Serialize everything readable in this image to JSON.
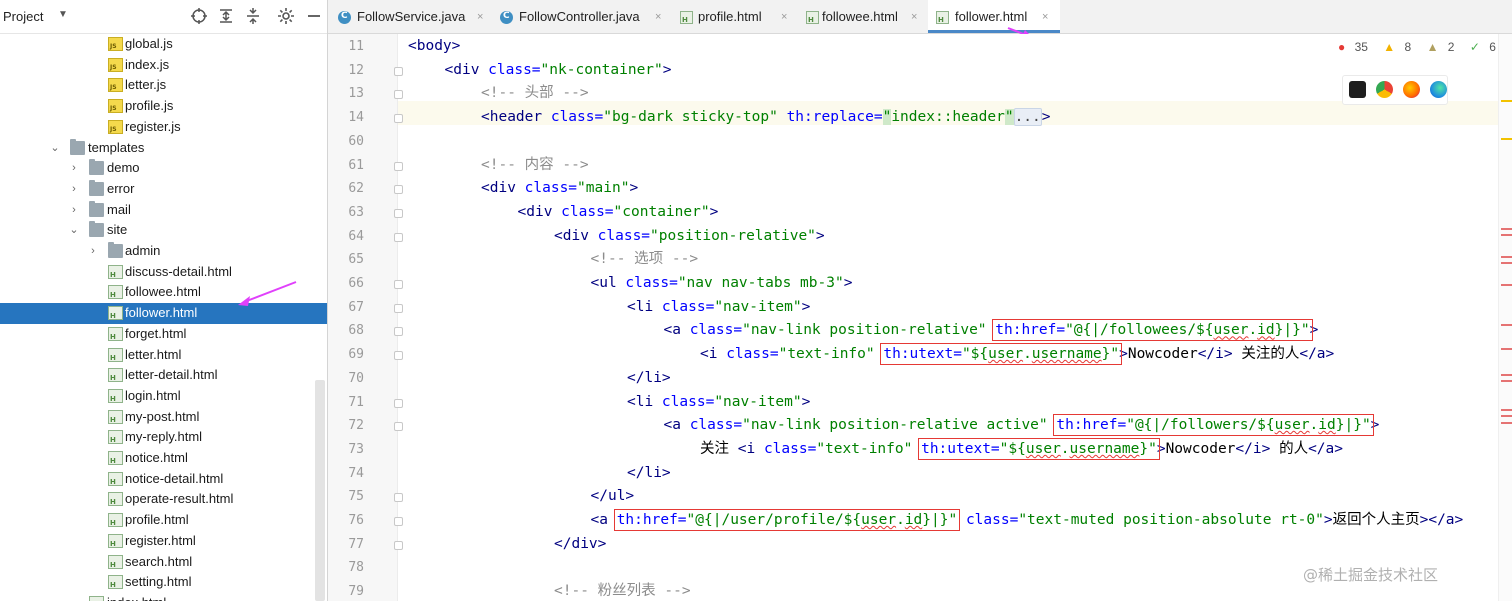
{
  "project_panel": {
    "title": "Project",
    "dropdown": "▼",
    "tree": [
      {
        "label": "global.js",
        "type": "js",
        "level": 4
      },
      {
        "label": "index.js",
        "type": "js",
        "level": 4
      },
      {
        "label": "letter.js",
        "type": "js",
        "level": 4
      },
      {
        "label": "profile.js",
        "type": "js",
        "level": 4
      },
      {
        "label": "register.js",
        "type": "js",
        "level": 4
      },
      {
        "label": "templates",
        "type": "folder",
        "level": 2,
        "expanded": true
      },
      {
        "label": "demo",
        "type": "folder",
        "level": 3,
        "expanded": false
      },
      {
        "label": "error",
        "type": "folder",
        "level": 3,
        "expanded": false
      },
      {
        "label": "mail",
        "type": "folder",
        "level": 3,
        "expanded": false
      },
      {
        "label": "site",
        "type": "folder",
        "level": 3,
        "expanded": true
      },
      {
        "label": "admin",
        "type": "folder",
        "level": 4,
        "expanded": false
      },
      {
        "label": "discuss-detail.html",
        "type": "html",
        "level": 4
      },
      {
        "label": "followee.html",
        "type": "html",
        "level": 4
      },
      {
        "label": "follower.html",
        "type": "html",
        "level": 4,
        "selected": true
      },
      {
        "label": "forget.html",
        "type": "html",
        "level": 4
      },
      {
        "label": "letter.html",
        "type": "html",
        "level": 4
      },
      {
        "label": "letter-detail.html",
        "type": "html",
        "level": 4
      },
      {
        "label": "login.html",
        "type": "html",
        "level": 4
      },
      {
        "label": "my-post.html",
        "type": "html",
        "level": 4
      },
      {
        "label": "my-reply.html",
        "type": "html",
        "level": 4
      },
      {
        "label": "notice.html",
        "type": "html",
        "level": 4
      },
      {
        "label": "notice-detail.html",
        "type": "html",
        "level": 4
      },
      {
        "label": "operate-result.html",
        "type": "html",
        "level": 4
      },
      {
        "label": "profile.html",
        "type": "html",
        "level": 4
      },
      {
        "label": "register.html",
        "type": "html",
        "level": 4
      },
      {
        "label": "search.html",
        "type": "html",
        "level": 4
      },
      {
        "label": "setting.html",
        "type": "html",
        "level": 4
      },
      {
        "label": "index.html",
        "type": "html",
        "level": 3
      }
    ]
  },
  "tabs": [
    {
      "label": "FollowService.java",
      "type": "java",
      "close": "×"
    },
    {
      "label": "FollowController.java",
      "type": "java",
      "close": "×"
    },
    {
      "label": "profile.html",
      "type": "html",
      "close": "×"
    },
    {
      "label": "followee.html",
      "type": "html",
      "close": "×"
    },
    {
      "label": "follower.html",
      "type": "html",
      "close": "×",
      "active": true
    }
  ],
  "inspections": {
    "errors": "35",
    "warnings": "8",
    "weak_warnings": "2",
    "ok": "6"
  },
  "line_numbers": [
    "11",
    "12",
    "13",
    "14",
    "60",
    "61",
    "62",
    "63",
    "64",
    "65",
    "66",
    "67",
    "68",
    "69",
    "70",
    "71",
    "72",
    "73",
    "74",
    "75",
    "76",
    "77",
    "78",
    "79"
  ],
  "code": [
    [
      [
        "t",
        "<body>"
      ]
    ],
    [
      [
        "t",
        "<div "
      ],
      [
        "a",
        "class="
      ],
      [
        "v",
        "\"nk-container\""
      ],
      [
        "t",
        ">"
      ]
    ],
    [
      [
        "c",
        "<!-- 头部 -->"
      ]
    ],
    [
      [
        "t",
        "<header "
      ],
      [
        "a",
        "class="
      ],
      [
        "v",
        "\"bg-dark sticky-top\" "
      ],
      [
        "a",
        "th:replace="
      ],
      [
        "q",
        "\""
      ],
      [
        "v",
        "index::header"
      ],
      [
        "q",
        "\""
      ],
      [
        "f",
        "..."
      ],
      [
        "t",
        ">"
      ]
    ],
    [],
    [
      [
        "c",
        "<!-- 内容 -->"
      ]
    ],
    [
      [
        "t",
        "<div "
      ],
      [
        "a",
        "class="
      ],
      [
        "v",
        "\"main\""
      ],
      [
        "t",
        ">"
      ]
    ],
    [
      [
        "t",
        "<div "
      ],
      [
        "a",
        "class="
      ],
      [
        "v",
        "\"container\""
      ],
      [
        "t",
        ">"
      ]
    ],
    [
      [
        "t",
        "<div "
      ],
      [
        "a",
        "class="
      ],
      [
        "v",
        "\"position-relative\""
      ],
      [
        "t",
        ">"
      ]
    ],
    [
      [
        "c",
        "<!-- 选项 -->"
      ]
    ],
    [
      [
        "t",
        "<ul "
      ],
      [
        "a",
        "class="
      ],
      [
        "v",
        "\"nav nav-tabs mb-3\""
      ],
      [
        "t",
        ">"
      ]
    ],
    [
      [
        "t",
        "<li "
      ],
      [
        "a",
        "class="
      ],
      [
        "v",
        "\"nav-item\""
      ],
      [
        "t",
        ">"
      ]
    ],
    [
      [
        "t",
        "<a "
      ],
      [
        "a",
        "class="
      ],
      [
        "v",
        "\"nav-link position-relative\" "
      ],
      [
        "hb",
        [
          [
            "a",
            "th:href="
          ],
          [
            "v",
            "\"@{|/followees/${"
          ],
          [
            "vs",
            "user"
          ],
          [
            "v",
            "."
          ],
          [
            "vs",
            "id"
          ],
          [
            "v",
            "}|}\""
          ]
        ]
      ],
      [
        "t",
        ">"
      ]
    ],
    [
      [
        "t",
        "<i "
      ],
      [
        "a",
        "class="
      ],
      [
        "v",
        "\"text-info\" "
      ],
      [
        "hb",
        [
          [
            "a",
            "th:utext="
          ],
          [
            "v",
            "\"${"
          ],
          [
            "vs",
            "user"
          ],
          [
            "v",
            "."
          ],
          [
            "vs",
            "username"
          ],
          [
            "v",
            "}\""
          ]
        ]
      ],
      [
        "t",
        ">"
      ],
      [
        "x",
        "Nowcoder"
      ],
      [
        "t",
        "</i>"
      ],
      [
        "x",
        " 关注的人"
      ],
      [
        "t",
        "</a>"
      ]
    ],
    [
      [
        "t",
        "</li>"
      ]
    ],
    [
      [
        "t",
        "<li "
      ],
      [
        "a",
        "class="
      ],
      [
        "v",
        "\"nav-item\""
      ],
      [
        "t",
        ">"
      ]
    ],
    [
      [
        "t",
        "<a "
      ],
      [
        "a",
        "class="
      ],
      [
        "v",
        "\"nav-link position-relative active\" "
      ],
      [
        "hb",
        [
          [
            "a",
            "th:href="
          ],
          [
            "v",
            "\"@{|/followers/${"
          ],
          [
            "vs",
            "user"
          ],
          [
            "v",
            "."
          ],
          [
            "vs",
            "id"
          ],
          [
            "v",
            "}|}\""
          ]
        ]
      ],
      [
        "t",
        ">"
      ]
    ],
    [
      [
        "x",
        "关注 "
      ],
      [
        "t",
        "<i "
      ],
      [
        "a",
        "class="
      ],
      [
        "v",
        "\"text-info\" "
      ],
      [
        "hb",
        [
          [
            "a",
            "th:utext="
          ],
          [
            "v",
            "\"${"
          ],
          [
            "vs",
            "user"
          ],
          [
            "v",
            "."
          ],
          [
            "vs",
            "username"
          ],
          [
            "v",
            "}\""
          ]
        ]
      ],
      [
        "t",
        ">"
      ],
      [
        "x",
        "Nowcoder"
      ],
      [
        "t",
        "</i>"
      ],
      [
        "x",
        " 的人"
      ],
      [
        "t",
        "</a>"
      ]
    ],
    [
      [
        "t",
        "</li>"
      ]
    ],
    [
      [
        "t",
        "</ul>"
      ]
    ],
    [
      [
        "t",
        "<a "
      ],
      [
        "hb",
        [
          [
            "a",
            "th:href="
          ],
          [
            "v",
            "\"@{|/user/profile/${"
          ],
          [
            "vs",
            "user"
          ],
          [
            "v",
            "."
          ],
          [
            "vs",
            "id"
          ],
          [
            "v",
            "}|}\""
          ]
        ]
      ],
      [
        "t",
        " "
      ],
      [
        "a",
        "class="
      ],
      [
        "v",
        "\"text-muted position-absolute rt-0\""
      ],
      [
        "t",
        ">"
      ],
      [
        "x",
        "返回个人主页"
      ],
      [
        "t",
        "></a>"
      ]
    ],
    [
      [
        "t",
        "</div>"
      ]
    ],
    [],
    [
      [
        "c",
        "<!-- 粉丝列表 -->"
      ]
    ]
  ],
  "code_indents": [
    0,
    1,
    2,
    2,
    0,
    2,
    2,
    3,
    4,
    5,
    5,
    6,
    7,
    8,
    6,
    6,
    7,
    8,
    6,
    5,
    5,
    4,
    0,
    4
  ],
  "watermark": "@稀土掘金技术社区",
  "colors": {
    "selection": "#2675bf",
    "accent_tab": "#4a88c7",
    "highlight_box": "#e53935",
    "annotation_arrow": "#e040fb"
  }
}
